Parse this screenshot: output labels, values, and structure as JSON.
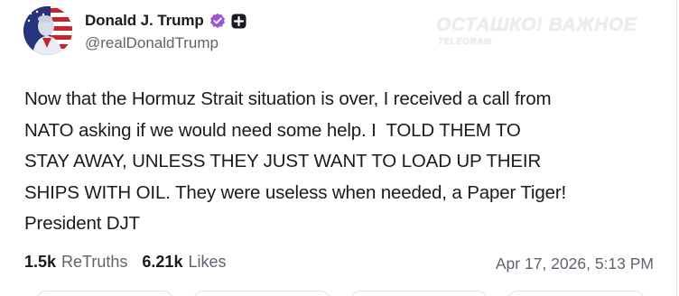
{
  "author": {
    "display_name": "Donald J. Trump",
    "handle": "@realDonaldTrump",
    "avatar_icon": "avatar-flag-portrait",
    "verified_icon": "verified-badge-icon",
    "verified_color": "#9b55d6",
    "plus_badge_icon": "plus-badge-icon"
  },
  "watermark": {
    "title": "ОСТАШКО! ВАЖНОЕ",
    "subtitle": "TELEGRAM"
  },
  "post": {
    "text": "Now that the Hormuz Strait situation is over, I received a call from\nNATO asking if we would need some help. I  TOLD THEM TO\nSTAY AWAY, UNLESS THEY JUST WANT TO LOAD UP THEIR\nSHIPS WITH OIL. They were useless when needed, a Paper Tiger!\nPresident DJT",
    "timestamp": "Apr 17, 2026, 5:13 PM"
  },
  "stats": {
    "retruths_count": "1.5k",
    "retruths_label": "ReTruths",
    "likes_count": "6.21k",
    "likes_label": "Likes"
  }
}
